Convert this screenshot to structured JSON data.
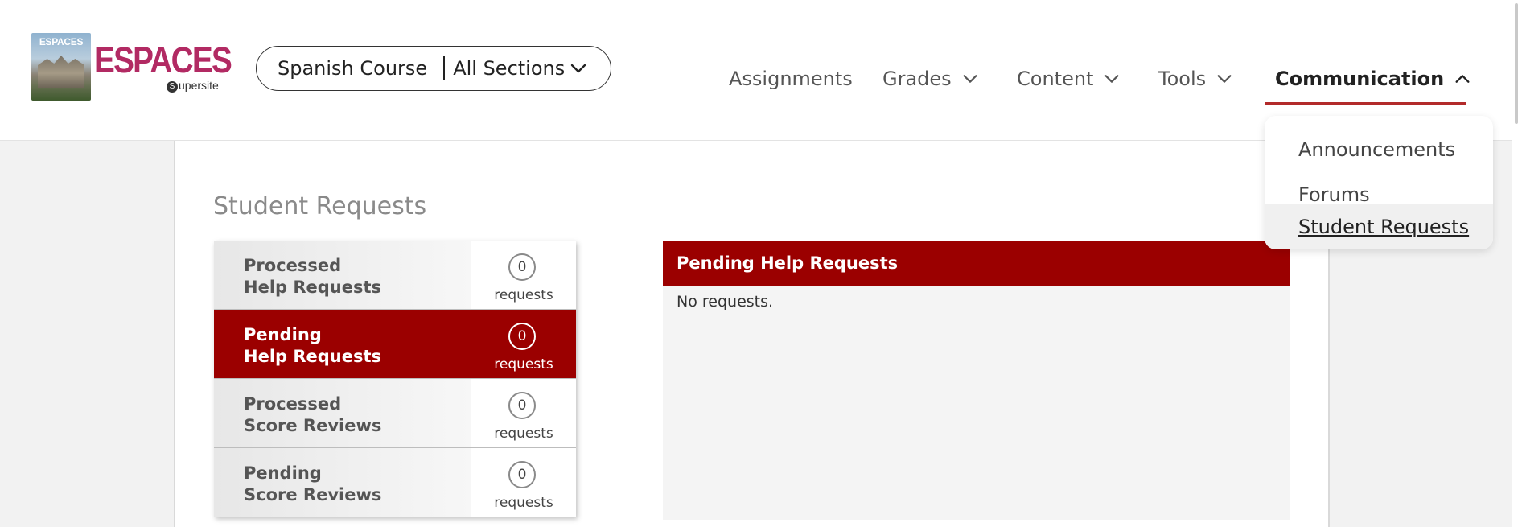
{
  "brand": {
    "cover_title": "ESPACES",
    "wordmark": "ESPACES",
    "sub_icon": "S",
    "sub_text": "upersite"
  },
  "course_selector": {
    "course": "Spanish Course",
    "section": "All Sections",
    "icon": "chevron-down-icon"
  },
  "nav": {
    "items": [
      {
        "label": "Assignments",
        "icon": null
      },
      {
        "label": "Grades",
        "icon": "chevron-down-icon"
      },
      {
        "label": "Content",
        "icon": "chevron-down-icon"
      },
      {
        "label": "Tools",
        "icon": "chevron-down-icon"
      },
      {
        "label": "Communication",
        "icon": "chevron-up-icon",
        "active": true
      }
    ],
    "accent_color": "#b22a2a"
  },
  "communication_menu": {
    "items": [
      {
        "label": "Announcements"
      },
      {
        "label": "Forums"
      },
      {
        "label": "Student Requests",
        "selected": true
      }
    ]
  },
  "page": {
    "title": "Student Requests"
  },
  "request_list": {
    "rows": [
      {
        "line1": "Processed",
        "line2": "Help Requests",
        "count": "0",
        "unit": "requests",
        "active": false
      },
      {
        "line1": "Pending",
        "line2": "Help Requests",
        "count": "0",
        "unit": "requests",
        "active": true
      },
      {
        "line1": "Processed",
        "line2": "Score Reviews",
        "count": "0",
        "unit": "requests",
        "active": false
      },
      {
        "line1": "Pending",
        "line2": "Score Reviews",
        "count": "0",
        "unit": "requests",
        "active": false
      }
    ],
    "active_color": "#9b0000"
  },
  "detail": {
    "header": "Pending Help Requests",
    "body": "No requests."
  }
}
